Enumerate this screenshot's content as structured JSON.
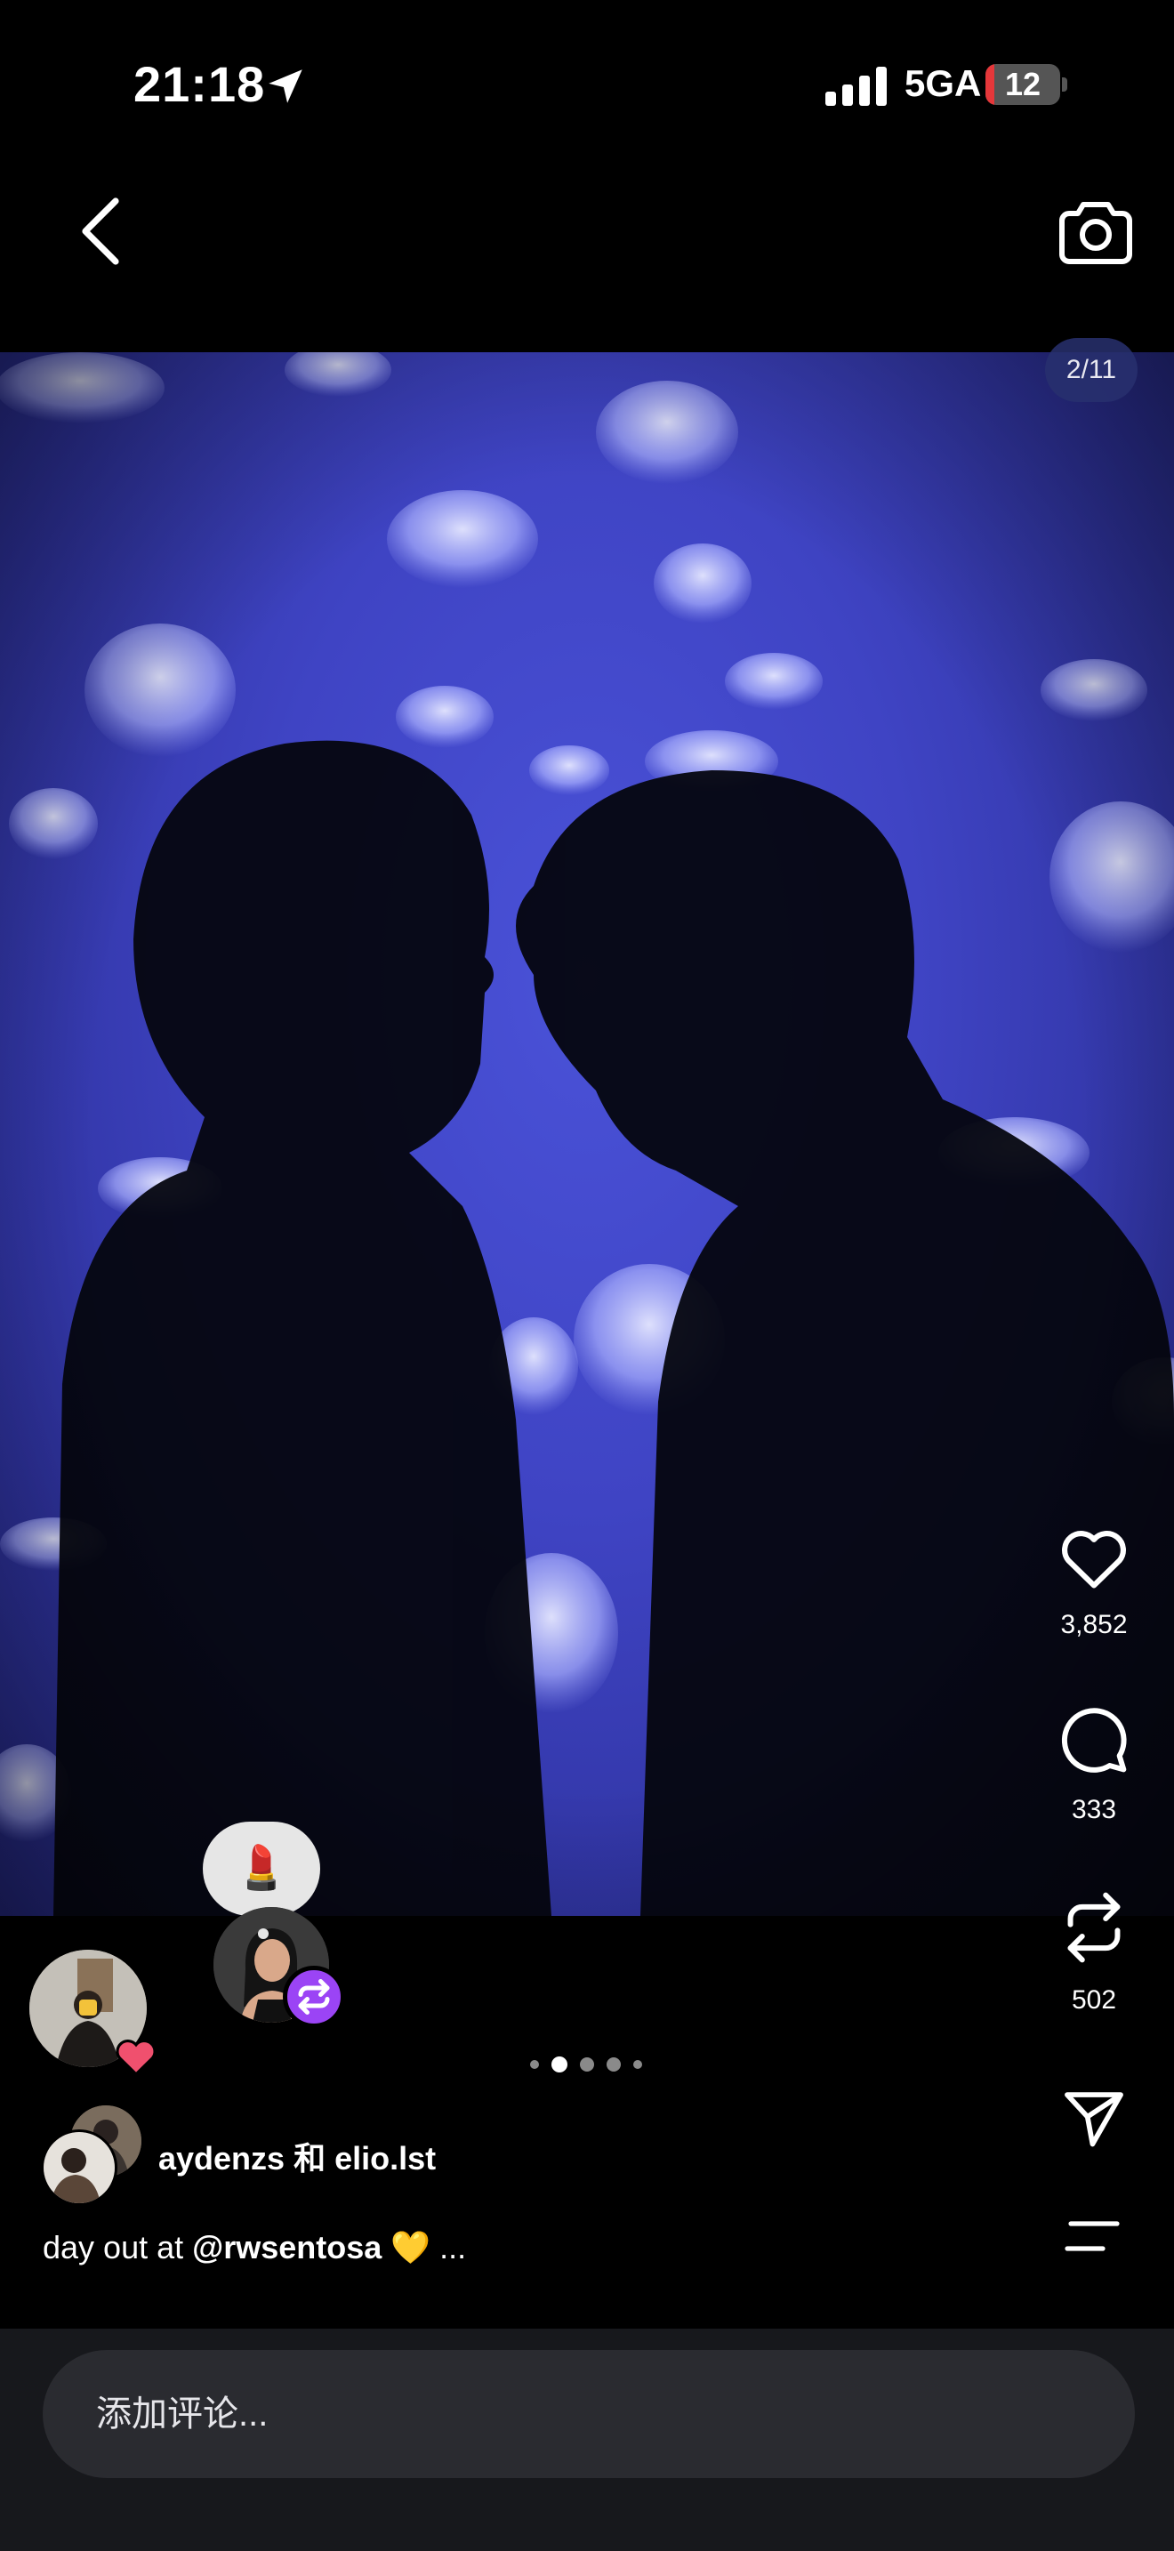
{
  "status_bar": {
    "time": "21:18",
    "network": "5GA",
    "battery": "12",
    "battery_level": 0.12,
    "icons": [
      "location-arrow-icon",
      "signal-bars-icon",
      "battery-icon"
    ]
  },
  "nav": {
    "back_icon": "chevron-left-icon",
    "camera_icon": "camera-icon"
  },
  "post": {
    "image_counter": "2/11",
    "image_alt": "Two silhouettes facing each other in front of a blue jellyfish tank"
  },
  "actions": {
    "like": {
      "icon": "heart-icon",
      "count": "3,852"
    },
    "comment": {
      "icon": "comment-bubble-icon",
      "count": "333"
    },
    "repost": {
      "icon": "repost-icon",
      "count": "502"
    },
    "share": {
      "icon": "send-icon"
    },
    "more": {
      "icon": "menu-lines-icon"
    }
  },
  "overlay": {
    "note_emoji": "💄",
    "repost_badge_icon": "repost-icon",
    "like_badge_icon": "heart-icon"
  },
  "carousel": {
    "total_dots": 5,
    "active_index": 1
  },
  "author": {
    "names": "aydenzs 和 elio.lst"
  },
  "caption": {
    "prefix": "day out at ",
    "mention": "@rwsentosa",
    "suffix": " 💛 ..."
  },
  "comment_box": {
    "placeholder": "添加评论..."
  },
  "colors": {
    "background": "#000000",
    "photo_blue": "#3f44c4",
    "repost_badge": "#9b44f5",
    "like_badge": "#f0506e",
    "battery_low": "#e5373a",
    "comment_bar": "#17181c"
  }
}
